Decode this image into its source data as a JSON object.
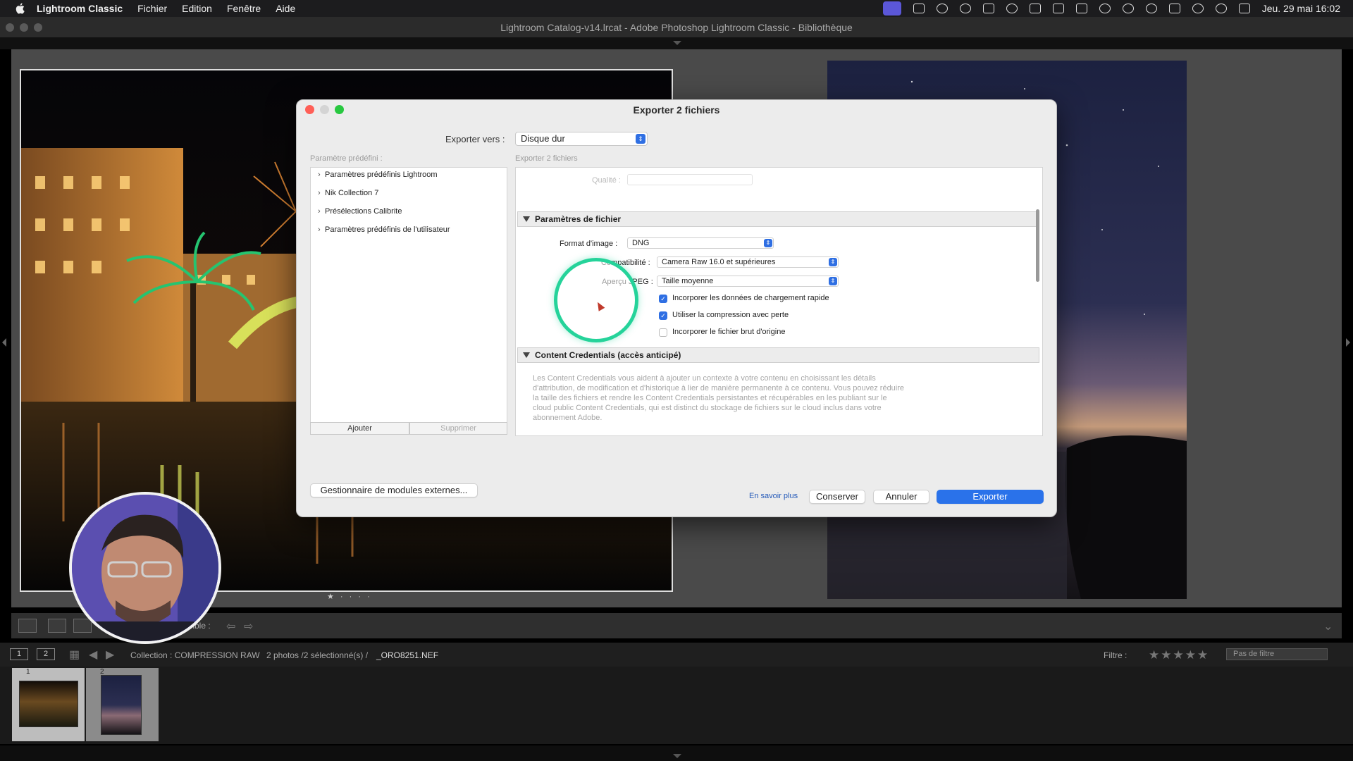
{
  "menubar": {
    "app": "Lightroom Classic",
    "items": [
      "Fichier",
      "Edition",
      "Fenêtre",
      "Aide"
    ],
    "clock": "Jeu. 29 mai  16:02"
  },
  "window": {
    "title": "Lightroom Catalog-v14.lrcat - Adobe Photoshop Lightroom Classic - Bibliothèque"
  },
  "toolbar": {
    "sort_label": "mble :"
  },
  "filmhead": {
    "screen1": "1",
    "screen2": "2",
    "collection": "Collection : COMPRESSION RAW",
    "count": "2 photos /2 sélectionné(s) /",
    "filename": "_ORO8251.NEF",
    "filter_label": "Filtre :",
    "stars": "★★★★★",
    "filter_value": "Pas de filtre"
  },
  "filmstrip": {
    "idx1": "1",
    "idx2": "2"
  },
  "pager": "★ · · · ·",
  "dialog": {
    "title": "Exporter 2 fichiers",
    "export_to_label": "Exporter vers :",
    "export_to_value": "Disque dur",
    "preset_label": "Paramètre prédéfini :",
    "right_caption": "Exporter 2 fichiers",
    "presets": [
      "Paramètres prédéfinis Lightroom",
      "Nik Collection 7",
      "Présélections Calibrite",
      "Paramètres prédéfinis de l'utilisateur"
    ],
    "add_btn": "Ajouter",
    "remove_btn": "Supprimer",
    "quality_label": "Qualité :",
    "file_section": "Paramètres de fichier",
    "format_label": "Format d'image :",
    "format_value": "DNG",
    "compat_label": "Compatibilité :",
    "compat_value": "Camera Raw 16.0 et supérieures",
    "jpeg_label": "Aperçu JPEG :",
    "jpeg_value": "Taille moyenne",
    "cb1": "Incorporer les données de chargement rapide",
    "cb2": "Utiliser la compression avec perte",
    "cb3": "Incorporer le fichier brut d'origine",
    "cc_section": "Content Credentials (accès anticipé)",
    "cc_text": "Les Content Credentials vous aident à ajouter un contexte à votre contenu en choisissant les détails d'attribution, de modification et d'historique à lier de manière permanente à ce contenu. Vous pouvez réduire la taille des fichiers et rendre les Content Credentials persistantes et récupérables en les publiant sur le cloud public Content Credentials, qui est distinct du stockage de fichiers sur le cloud inclus dans votre abonnement Adobe.",
    "plugin_btn": "Gestionnaire de modules externes...",
    "learn_more": "En savoir plus",
    "save_btn": "Conserver",
    "cancel_btn": "Annuler",
    "export_btn": "Exporter"
  },
  "colors": {
    "accent": "#2a72ea",
    "highlight_ring": "#25d39a",
    "window_bg": "#4a4a4a"
  }
}
